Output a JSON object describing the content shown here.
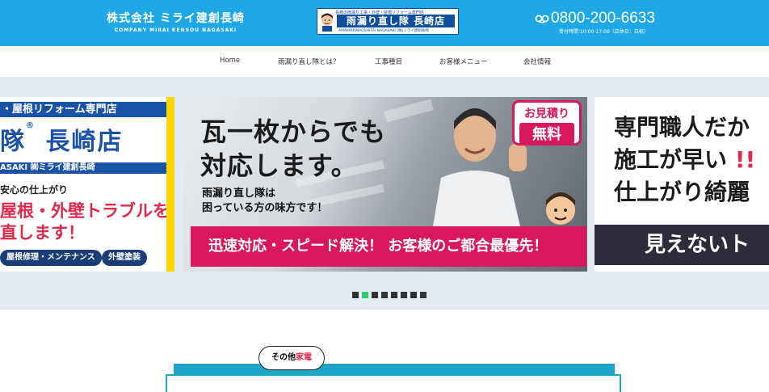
{
  "header": {
    "company_name": "株式会社 ミライ建創長崎",
    "company_sub": "COMPANY MIRAI KENSOU NAGASAKI",
    "logo": {
      "tagline": "長崎の雨漏り工事・外壁・屋根リフォーム専門店",
      "main": "雨漏り直し隊 長崎店",
      "sub": "AMAMORINAOSHITAI NAGASAKI  (株)ミライ建創長崎"
    },
    "phone_icon": "free-dial-icon",
    "phone": "0800-200-6633",
    "hours": "受付時間:10:00-17:00（店休日：日祝）"
  },
  "nav": {
    "items": [
      {
        "label": "Home"
      },
      {
        "label": "雨漏り直し隊とは？"
      },
      {
        "label": "工事種目"
      },
      {
        "label": "お客様メニュー"
      },
      {
        "label": "会社情報"
      }
    ]
  },
  "slider": {
    "left": {
      "band": "・屋根リフォーム専門店",
      "name": "隊",
      "name_reg": "®",
      "name_store": " 長崎店",
      "strip": "ASAKI  ㈱ミライ建創長崎",
      "line1": "安心の仕上がり",
      "line2": "屋根・外壁トラブルを",
      "line3": "直します！",
      "pill1": "屋根修理・メンテナンス",
      "pill2": "外壁塗装"
    },
    "main": {
      "title1": "瓦一枚からでも",
      "title2": "対応します。",
      "sub1": "雨漏り直し隊は",
      "sub2": "困っている方の味方です！",
      "bar": "迅速対応・スピード解決！ お客様のご都合最優先！",
      "badge1": "お見積り",
      "badge2": "無料"
    },
    "right": {
      "line1": "専門職人だか",
      "line2": "施工が早い",
      "line2_ex": "!!",
      "line3": "仕上がり綺麗",
      "bar": "見えないト"
    },
    "dots_count": 8,
    "active_dot": 1
  },
  "section": {
    "bubble_prefix": "その他",
    "bubble_red": "家電"
  }
}
